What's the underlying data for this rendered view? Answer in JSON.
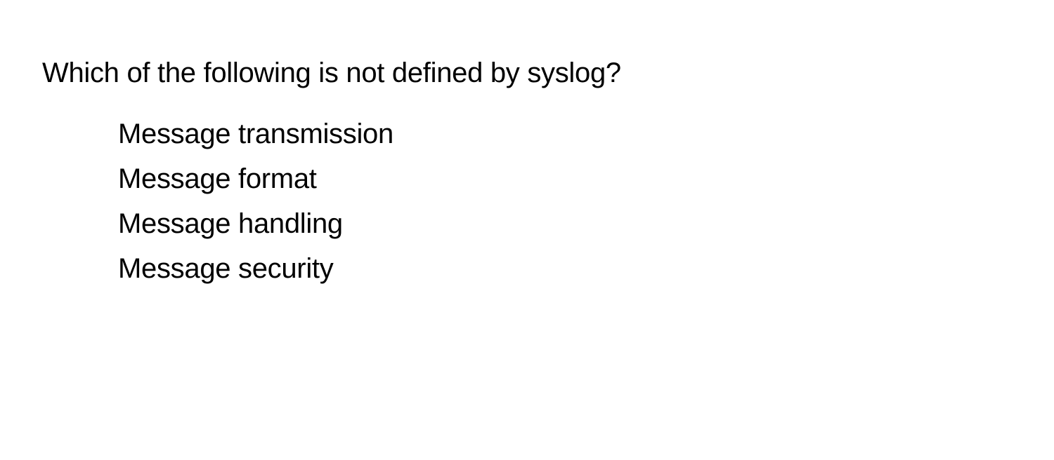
{
  "question": {
    "text": "Which of the following is not defined by syslog?",
    "options": [
      "Message transmission",
      "Message format",
      "Message handling",
      "Message security"
    ]
  }
}
